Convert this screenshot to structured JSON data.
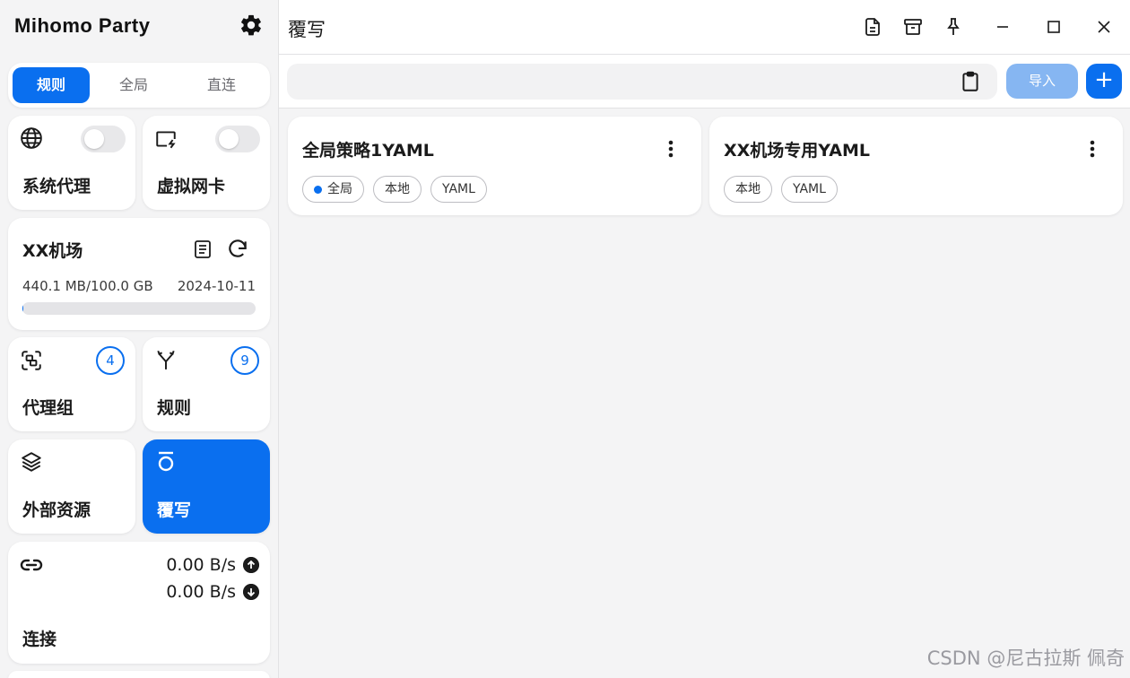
{
  "app": {
    "title": "Mihomo Party"
  },
  "sidebar": {
    "mode_tabs": [
      {
        "label": "规则",
        "active": true
      },
      {
        "label": "全局",
        "active": false
      },
      {
        "label": "直连",
        "active": false
      }
    ],
    "system_proxy": {
      "label": "系统代理",
      "enabled": false
    },
    "tun": {
      "label": "虚拟网卡",
      "enabled": false
    },
    "subscription": {
      "name": "XX机场",
      "usage": "440.1 MB/100.0 GB",
      "expire": "2024-10-11",
      "usage_fraction": 0.004
    },
    "proxy_groups": {
      "label": "代理组",
      "count": "4"
    },
    "rules": {
      "label": "规则",
      "count": "9"
    },
    "resources": {
      "label": "外部资源"
    },
    "override": {
      "label": "覆写",
      "active": true
    },
    "connections": {
      "label": "连接",
      "upload": "0.00 B/s",
      "download": "0.00 B/s"
    }
  },
  "header": {
    "title": "覆写"
  },
  "toolbar": {
    "url_placeholder": "",
    "import_label": "导入",
    "add_label": "+"
  },
  "overrides": [
    {
      "title": "全局策略1YAML",
      "tags": [
        "全局",
        "本地",
        "YAML"
      ],
      "global": true
    },
    {
      "title": "XX机场专用YAML",
      "tags": [
        "本地",
        "YAML"
      ],
      "global": false
    }
  ],
  "watermark": "CSDN @尼古拉斯 佩奇",
  "colors": {
    "accent": "#0a6fef",
    "import_disabled": "#86b6f2",
    "sidebar_bg": "#f4f4f5"
  }
}
